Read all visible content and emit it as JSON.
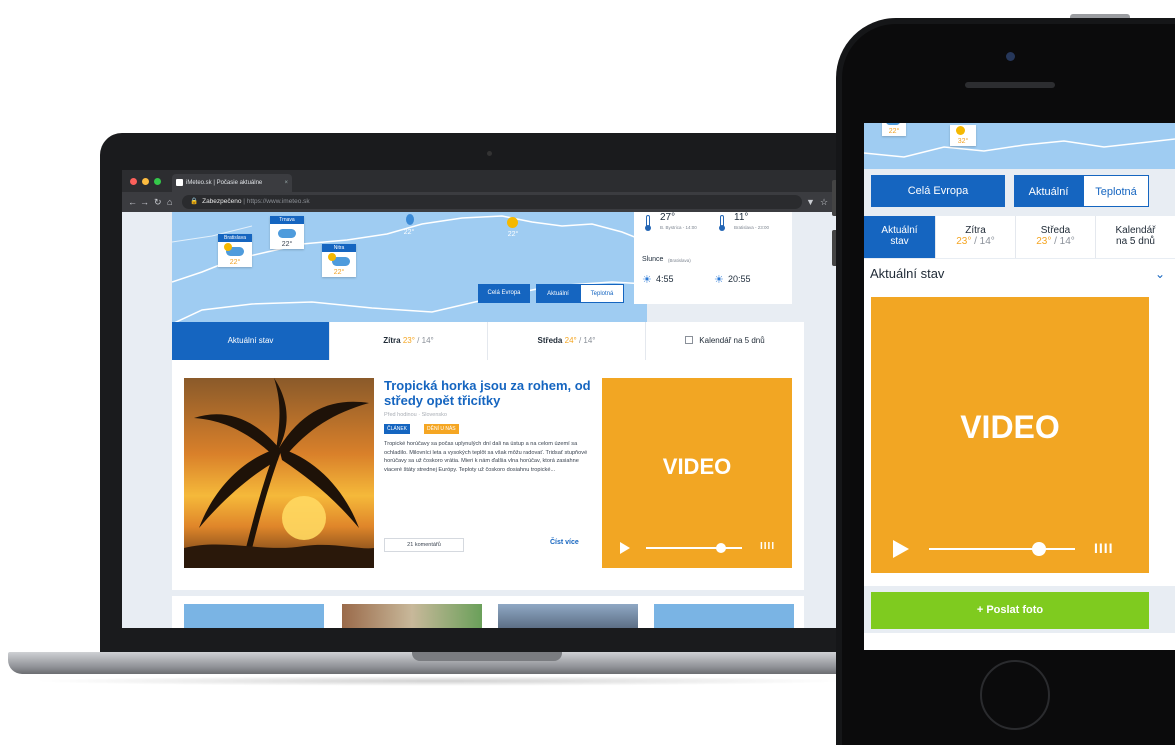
{
  "colors": {
    "brand_blue": "#1565c0",
    "map_blue": "#9fccf2",
    "video_orange": "#f2a623",
    "send_green": "#7fcb1f",
    "temp_high": "#f5a623"
  },
  "browser": {
    "tab_title": "iMeteo.sk | Počasie aktuálne",
    "url_secure": "Zabezpečeno",
    "url_text": "https://www.imeteo.sk"
  },
  "map": {
    "cities": [
      {
        "name": "Bratislava",
        "temp": "22°"
      },
      {
        "name": "Trnava",
        "temp": "22°"
      },
      {
        "name": "Nitra",
        "temp": "22°"
      },
      {
        "name": "",
        "temp": "22°"
      },
      {
        "name": "",
        "temp": "22°"
      }
    ],
    "buttons": {
      "europe": "Celá Evropa",
      "current": "Aktuální",
      "temperature": "Teplotná"
    }
  },
  "info": {
    "max_temp": "27°",
    "max_place": "B. Bystrica - 14:00",
    "min_temp": "11°",
    "min_place": "Bratislava - 23:00",
    "sun_label": "Slunce",
    "sun_place": "(Bratislava)",
    "sunrise": "4:55",
    "sunset": "20:55"
  },
  "tabs": {
    "current": "Aktuální stav",
    "tomorrow": "Zítra",
    "tomorrow_high": "23°",
    "tomorrow_low": "14°",
    "wednesday": "Středa",
    "wednesday_high": "24°",
    "wednesday_low": "14°",
    "calendar": "Kalendář na 5 dnů"
  },
  "article": {
    "title": "Tropická horka jsou za rohem, od středy opět třicítky",
    "meta": "Před hodinou · Slovensko",
    "badge_article": "ČLÁNEK",
    "badge_today": "DĚNÍ U NÁS",
    "body": "Tropické horúčavy sa počas uplynulých dní dali na ústup a na celom území sa ochladilo. Milovníci leta a vysokých teplôt sa však môžu radovať. Tridsať stupňové horúčavy sa už čoskoro vrátia. Mieri k nám ďalšia vlna horúčav, ktorá zasiahne viaceré štáty strednej Európy. Teploty už čoskoro dosiahnu tropické...",
    "comments": "21 komentářů",
    "read_more": "Číst více"
  },
  "video": {
    "label": "VIDEO",
    "progress": 0.7,
    "volume_icon": "IIII"
  },
  "phone": {
    "buttons": {
      "europe": "Celá Evropa",
      "current": "Aktuální",
      "temperature": "Teplotná"
    },
    "tabs": {
      "current_line1": "Aktuální",
      "current_line2": "stav",
      "tomorrow": "Zítra",
      "tomorrow_high": "23°",
      "tomorrow_low": "14°",
      "wednesday": "Středa",
      "wednesday_high": "23°",
      "wednesday_low": "14°",
      "calendar_line1": "Kalendář",
      "calendar_line2": "na 5 dnů"
    },
    "section_title": "Aktuální stav",
    "video_label": "VIDEO",
    "send_photo": "+ Poslat foto",
    "map_temps": [
      "22°",
      "32°"
    ]
  }
}
